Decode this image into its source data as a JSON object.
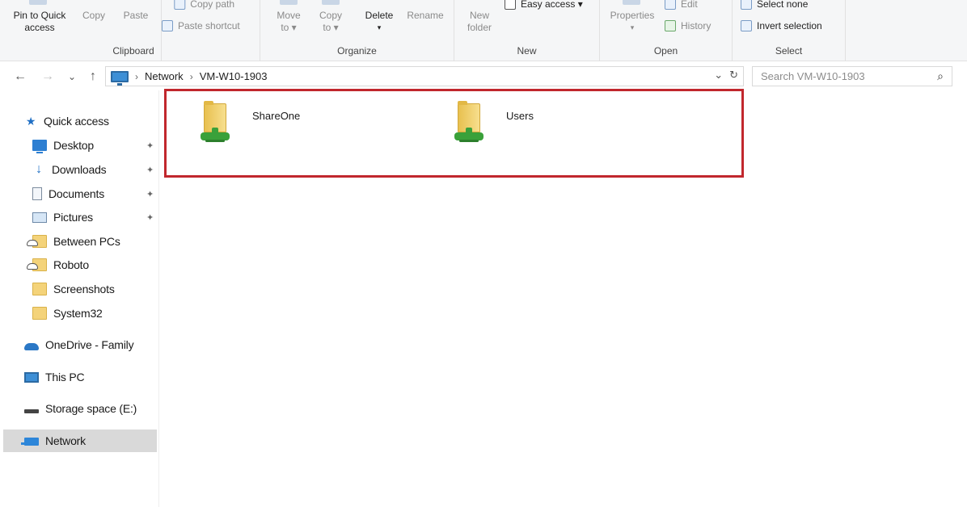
{
  "ribbon": {
    "clipboard": {
      "label": "Clipboard",
      "pin_label_1": "Pin to Quick",
      "pin_label_2": "access",
      "copy": "Copy",
      "paste": "Paste",
      "copy_path": "Copy path",
      "paste_shortcut": "Paste shortcut"
    },
    "organize": {
      "label": "Organize",
      "move_to_1": "Move",
      "move_to_2": "to ▾",
      "copy_to_1": "Copy",
      "copy_to_2": "to ▾",
      "delete": "Delete",
      "delete_arrow": "▾",
      "rename": "Rename"
    },
    "new": {
      "label": "New",
      "new_folder_1": "New",
      "new_folder_2": "folder",
      "easy_access": "Easy access ▾"
    },
    "open": {
      "label": "Open",
      "properties": "Properties",
      "properties_arrow": "▾",
      "edit": "Edit",
      "history": "History"
    },
    "select": {
      "label": "Select",
      "select_none": "Select none",
      "invert_selection": "Invert selection"
    }
  },
  "navbar": {
    "back": "←",
    "forward": "→",
    "recent": "⌄",
    "up": "↑",
    "chevron": "›",
    "breadcrumb": [
      "Network",
      "VM-W10-1903"
    ],
    "dropdown": "⌄",
    "refresh": "↻",
    "search_placeholder": "Search VM-W10-1903",
    "search_icon": "⌕"
  },
  "navpane": {
    "pin_glyph": "📌",
    "items": [
      {
        "label": "Quick access",
        "icon": "star-icon"
      },
      {
        "label": "Desktop",
        "icon": "desktop-icon",
        "pinned": true
      },
      {
        "label": "Downloads",
        "icon": "download-icon",
        "pinned": true
      },
      {
        "label": "Documents",
        "icon": "document-icon",
        "pinned": true
      },
      {
        "label": "Pictures",
        "icon": "pictures-icon",
        "pinned": true
      },
      {
        "label": "Between PCs",
        "icon": "cloud-folder-icon"
      },
      {
        "label": "Roboto",
        "icon": "cloud-folder-icon"
      },
      {
        "label": "Screenshots",
        "icon": "folder-icon"
      },
      {
        "label": "System32",
        "icon": "folder-icon"
      },
      {
        "label": "OneDrive - Family",
        "icon": "onedrive-icon"
      },
      {
        "label": "This PC",
        "icon": "this-pc-icon"
      },
      {
        "label": "Storage space (E:)",
        "icon": "drive-icon"
      },
      {
        "label": "Network",
        "icon": "network-icon",
        "selected": true
      }
    ]
  },
  "content": {
    "shares": [
      {
        "name": "ShareOne",
        "icon": "network-share-folder-icon"
      },
      {
        "name": "Users",
        "icon": "network-share-folder-icon"
      }
    ],
    "highlight_color": "#c1272d"
  }
}
